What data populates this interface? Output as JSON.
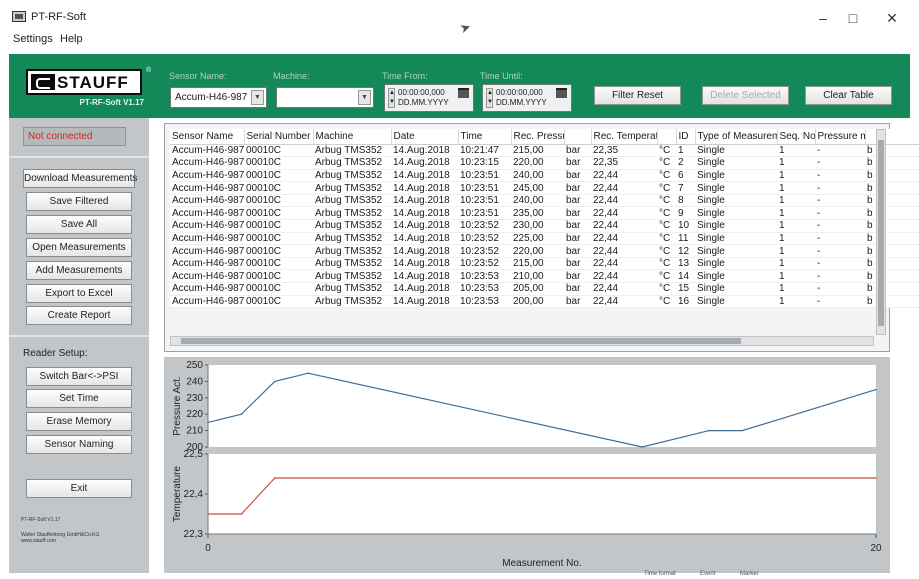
{
  "window": {
    "title": "PT-RF-Soft",
    "minimize": "–",
    "maximize": "□",
    "close": "✕"
  },
  "menu": [
    "Settings",
    "Help"
  ],
  "brand": {
    "logo_text": "STAUFF",
    "version": "PT-RF-Soft V1.17",
    "color": "#138858"
  },
  "filters": {
    "sensor_name_label": "Sensor Name:",
    "sensor_name_value": "Accum-H46-987",
    "machine_label": "Machine:",
    "machine_value": "",
    "time_from_label": "Time From:",
    "time_from_value": "00:00:00,000",
    "time_from_format": "DD.MM.YYYY",
    "time_until_label": "Time Until:",
    "time_until_value": "00:00:00,000",
    "time_until_format": "DD.MM.YYYY"
  },
  "header_buttons": {
    "filter_reset": "Filter Reset",
    "delete_selected": "Delete Selected",
    "clear_table": "Clear Table"
  },
  "left_panel": {
    "connection_status": "Not connected",
    "buttons": [
      "Download Measurements",
      "Save Filtered",
      "Save All",
      "Open Measurements",
      "Add Measurements",
      "Export to Excel",
      "Create Report"
    ],
    "reader_setup_label": "Reader Setup:",
    "reader_buttons": [
      "Switch Bar<->PSI",
      "Set Time",
      "Erase Memory",
      "Sensor Naming"
    ],
    "exit": "Exit",
    "footer_version": "PT-RF-Soft V1.17",
    "footer_company": "Walter Stauffenberg GmbH&Co.KG",
    "footer_url": "www.stauff.com"
  },
  "table": {
    "columns": [
      "Sensor Name",
      "Serial Number",
      "Machine",
      "Date",
      "Time",
      "Rec. Pressure",
      "",
      "Rec. Temperature",
      "",
      "ID",
      "Type of Measurement",
      "Seq. No.",
      "Pressure ma",
      ""
    ],
    "rows": [
      [
        "Accum-H46-987",
        "00010C",
        "Arbug TMS352",
        "14.Aug.2018",
        "10:21:47",
        "215,00",
        "bar",
        "22,35",
        "°C",
        "1",
        "Single",
        "1",
        "-",
        "b"
      ],
      [
        "Accum-H46-987",
        "00010C",
        "Arbug TMS352",
        "14.Aug.2018",
        "10:23:15",
        "220,00",
        "bar",
        "22,35",
        "°C",
        "2",
        "Single",
        "1",
        "-",
        "b"
      ],
      [
        "Accum-H46-987",
        "00010C",
        "Arbug TMS352",
        "14.Aug.2018",
        "10:23:51",
        "240,00",
        "bar",
        "22,44",
        "°C",
        "6",
        "Single",
        "1",
        "-",
        "b"
      ],
      [
        "Accum-H46-987",
        "00010C",
        "Arbug TMS352",
        "14.Aug.2018",
        "10:23:51",
        "245,00",
        "bar",
        "22,44",
        "°C",
        "7",
        "Single",
        "1",
        "-",
        "b"
      ],
      [
        "Accum-H46-987",
        "00010C",
        "Arbug TMS352",
        "14.Aug.2018",
        "10:23:51",
        "240,00",
        "bar",
        "22,44",
        "°C",
        "8",
        "Single",
        "1",
        "-",
        "b"
      ],
      [
        "Accum-H46-987",
        "00010C",
        "Arbug TMS352",
        "14.Aug.2018",
        "10:23:51",
        "235,00",
        "bar",
        "22,44",
        "°C",
        "9",
        "Single",
        "1",
        "-",
        "b"
      ],
      [
        "Accum-H46-987",
        "00010C",
        "Arbug TMS352",
        "14.Aug.2018",
        "10:23:52",
        "230,00",
        "bar",
        "22,44",
        "°C",
        "10",
        "Single",
        "1",
        "-",
        "b"
      ],
      [
        "Accum-H46-987",
        "00010C",
        "Arbug TMS352",
        "14.Aug.2018",
        "10:23:52",
        "225,00",
        "bar",
        "22,44",
        "°C",
        "11",
        "Single",
        "1",
        "-",
        "b"
      ],
      [
        "Accum-H46-987",
        "00010C",
        "Arbug TMS352",
        "14.Aug.2018",
        "10:23:52",
        "220,00",
        "bar",
        "22,44",
        "°C",
        "12",
        "Single",
        "1",
        "-",
        "b"
      ],
      [
        "Accum-H46-987",
        "00010C",
        "Arbug TMS352",
        "14.Aug.2018",
        "10:23:52",
        "215,00",
        "bar",
        "22,44",
        "°C",
        "13",
        "Single",
        "1",
        "-",
        "b"
      ],
      [
        "Accum-H46-987",
        "00010C",
        "Arbug TMS352",
        "14.Aug.2018",
        "10:23:53",
        "210,00",
        "bar",
        "22,44",
        "°C",
        "14",
        "Single",
        "1",
        "-",
        "b"
      ],
      [
        "Accum-H46-987",
        "00010C",
        "Arbug TMS352",
        "14.Aug.2018",
        "10:23:53",
        "205,00",
        "bar",
        "22,44",
        "°C",
        "15",
        "Single",
        "1",
        "-",
        "b"
      ],
      [
        "Accum-H46-987",
        "00010C",
        "Arbug TMS352",
        "14.Aug.2018",
        "10:23:53",
        "200,00",
        "bar",
        "22,44",
        "°C",
        "16",
        "Single",
        "1",
        "-",
        "b"
      ]
    ]
  },
  "chart_data": [
    {
      "type": "line",
      "ylabel": "Pressure Act.",
      "x": [
        0,
        1,
        2,
        3,
        13,
        15,
        16,
        20
      ],
      "y": [
        215,
        220,
        240,
        245,
        200,
        210,
        210,
        235
      ],
      "xlim": [
        0,
        20
      ],
      "ylim": [
        200,
        250
      ],
      "yticks": [
        "250",
        "240",
        "230",
        "220",
        "210",
        "200"
      ],
      "color": "#3f6d98"
    },
    {
      "type": "line",
      "ylabel": "Temperature",
      "xlabel": "Measurement No.",
      "x": [
        0,
        1,
        2,
        20
      ],
      "y": [
        22.35,
        22.35,
        22.44,
        22.44
      ],
      "xlim": [
        0,
        20
      ],
      "ylim": [
        22.3,
        22.5
      ],
      "yticks": [
        "22,5",
        "22,4",
        "22,3"
      ],
      "xticks": [
        "0",
        "20"
      ],
      "color": "#c9503c"
    }
  ],
  "status_bar": [
    "Time format",
    "Event",
    "Marker"
  ]
}
